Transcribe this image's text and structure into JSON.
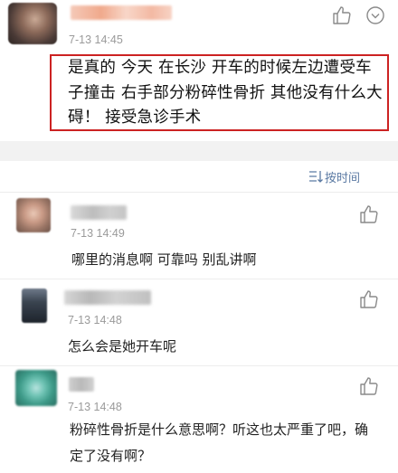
{
  "post": {
    "author_name": "",
    "time": "7-13 14:45",
    "text": "是真的 今天 在长沙 开车的时候左边遭受车子撞击 右手部分粉碎性骨折 其他没有什么大碍！ 接受急诊手术",
    "like_icon": "thumbs-up-icon",
    "more_icon": "chevron-down-icon",
    "highlight_color": "#cc2222"
  },
  "sort": {
    "icon": "sort-icon",
    "label": "按时间"
  },
  "comments": [
    {
      "author_name": "",
      "time": "7-13 14:49",
      "text": "哪里的消息啊 可靠吗 别乱讲啊",
      "like_icon": "thumbs-up-icon"
    },
    {
      "author_name": "",
      "time": "7-13 14:48",
      "text": "怎么会是她开车呢",
      "like_icon": "thumbs-up-icon"
    },
    {
      "author_name": "",
      "time": "7-13 14:48",
      "text": "粉碎性骨折是什么意思啊？听这也太严重了吧，确定了没有啊？",
      "like_icon": "thumbs-up-icon"
    }
  ]
}
